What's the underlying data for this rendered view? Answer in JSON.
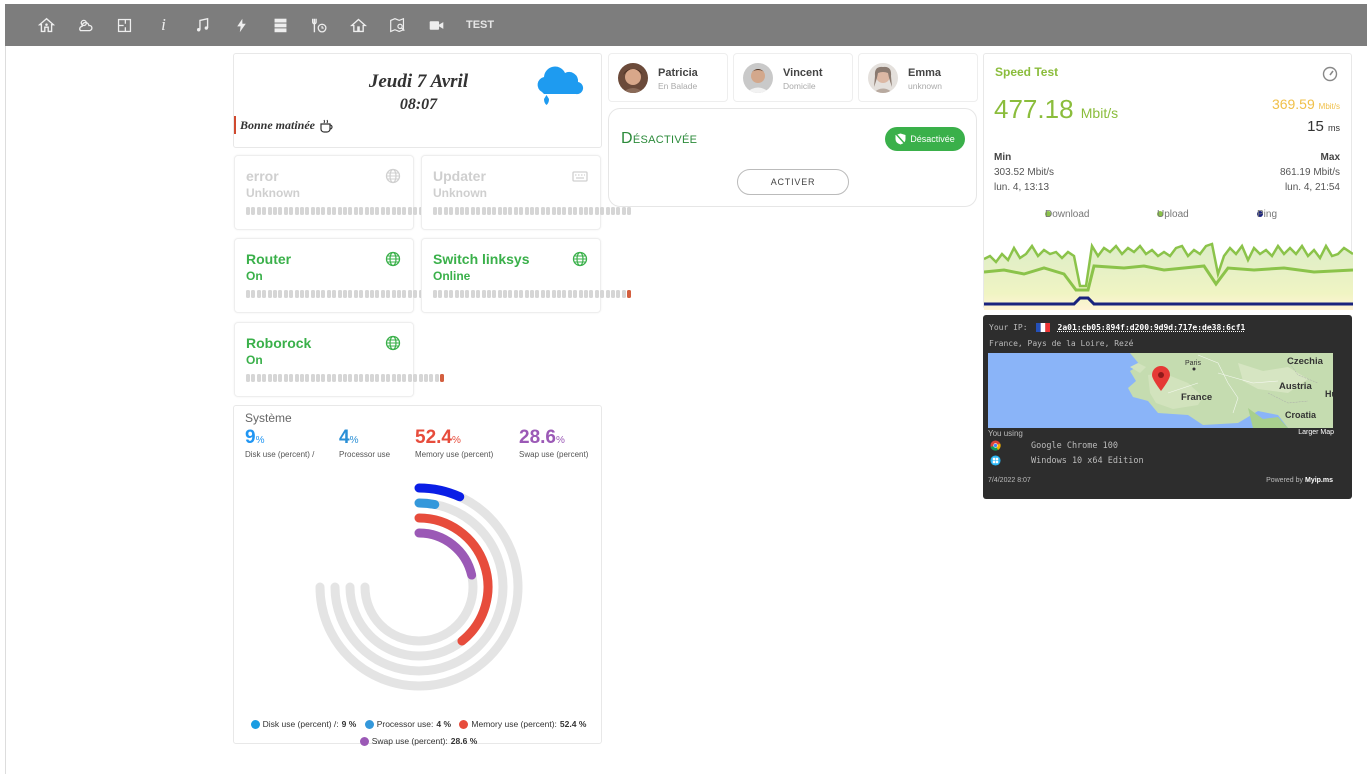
{
  "topbar": {
    "icons": [
      "home-icon",
      "weather-icon",
      "floorplan-icon",
      "info-icon",
      "music-icon",
      "energy-icon",
      "server-icon",
      "tools-icon",
      "house-icon",
      "map-icon",
      "camera-icon"
    ],
    "test_label": "TEST"
  },
  "datecard": {
    "date": "Jeudi 7 Avril",
    "time": "08:07",
    "greeting": "Bonne matinée",
    "weather_icon": "rain-cloud-icon"
  },
  "devices": [
    {
      "name": "error",
      "state": "Unknown",
      "icon": "globe-icon",
      "status": "off",
      "level": 0
    },
    {
      "name": "Updater",
      "state": "Unknown",
      "icon": "keyboard-icon",
      "status": "off",
      "level": 0
    },
    {
      "name": "Router",
      "state": "On",
      "icon": "globe-icon",
      "status": "on",
      "level": 1
    },
    {
      "name": "Switch linksys",
      "state": "Online",
      "icon": "globe-icon",
      "status": "on",
      "level": 1
    },
    {
      "name": "Roborock",
      "state": "On",
      "icon": "globe-icon",
      "status": "on",
      "level": 1
    }
  ],
  "system": {
    "title": "Système",
    "metrics": [
      {
        "value": "9",
        "unit": "%",
        "label": "Disk use (percent) /",
        "color": "#2196f3"
      },
      {
        "value": "4",
        "unit": "%",
        "label": "Processor use",
        "color": "#2a8fd6"
      },
      {
        "value": "52.4",
        "unit": "%",
        "label": "Memory use (percent)",
        "color": "#e74c3c"
      },
      {
        "value": "28.6",
        "unit": "%",
        "label": "Swap use (percent)",
        "color": "#9b59b6"
      }
    ],
    "legend": [
      {
        "label": "Disk use (percent) /:",
        "value": "9 %",
        "color": "#1a9de2"
      },
      {
        "label": "Processor use:",
        "value": "4 %",
        "color": "#3498db"
      },
      {
        "label": "Memory use (percent):",
        "value": "52.4 %",
        "color": "#e74c3c"
      },
      {
        "label": "Swap use (percent):",
        "value": "28.6 %",
        "color": "#9b59b6"
      }
    ]
  },
  "chart_data": {
    "type": "radial-bar",
    "categories": [
      "Disk use (percent) /",
      "Processor use",
      "Memory use (percent)",
      "Swap use (percent)"
    ],
    "values": [
      9,
      4,
      52.4,
      28.6
    ],
    "colors": [
      "#0a1ee6",
      "#3498db",
      "#e74c3c",
      "#9b59b6"
    ],
    "ylim": [
      0,
      100
    ]
  },
  "persons": [
    {
      "name": "Patricia",
      "status": "En Balade",
      "avatar": "avatar-patricia"
    },
    {
      "name": "Vincent",
      "status": "Domicile",
      "avatar": "avatar-vincent"
    },
    {
      "name": "Emma",
      "status": "unknown",
      "avatar": "avatar-emma"
    }
  ],
  "alarm": {
    "title": "Désactivée",
    "badge": "Désactivée",
    "button": "ACTIVER"
  },
  "speedtest": {
    "title": "Speed Test",
    "download": "477.18",
    "download_unit": "Mbit/s",
    "upload": "369.59",
    "upload_unit": "Mbit/s",
    "ping": "15",
    "ping_unit": "ms",
    "min_label": "Min",
    "max_label": "Max",
    "min_value": "303.52 Mbit/s",
    "max_value": "861.19 Mbit/s",
    "min_date": "lun. 4, 13:13",
    "max_date": "lun. 4, 21:54",
    "legend": [
      {
        "label": "Download",
        "color": "#8bc34a"
      },
      {
        "label": "Upload",
        "color": "#8bc34a"
      },
      {
        "label": "Ping",
        "color": "#1a237e"
      }
    ]
  },
  "myip": {
    "label": "Your IP:",
    "ip": "2a01:cb05:894f:d200:9d9d:717e:de38:6cf1",
    "location": "France, Pays de la Loire, Rezé",
    "map_labels": {
      "paris": "Paris",
      "czechia": "Czechia",
      "austria": "Austria",
      "france": "France",
      "croatia": "Croatia",
      "hu": "Hu"
    },
    "using": "You using",
    "larger": "Larger Map",
    "browser": "Google Chrome 100",
    "os": "Windows 10 x64 Edition",
    "date": "7/4/2022 8:07",
    "powered": "Powered by",
    "powered_brand": "Myip.ms"
  }
}
